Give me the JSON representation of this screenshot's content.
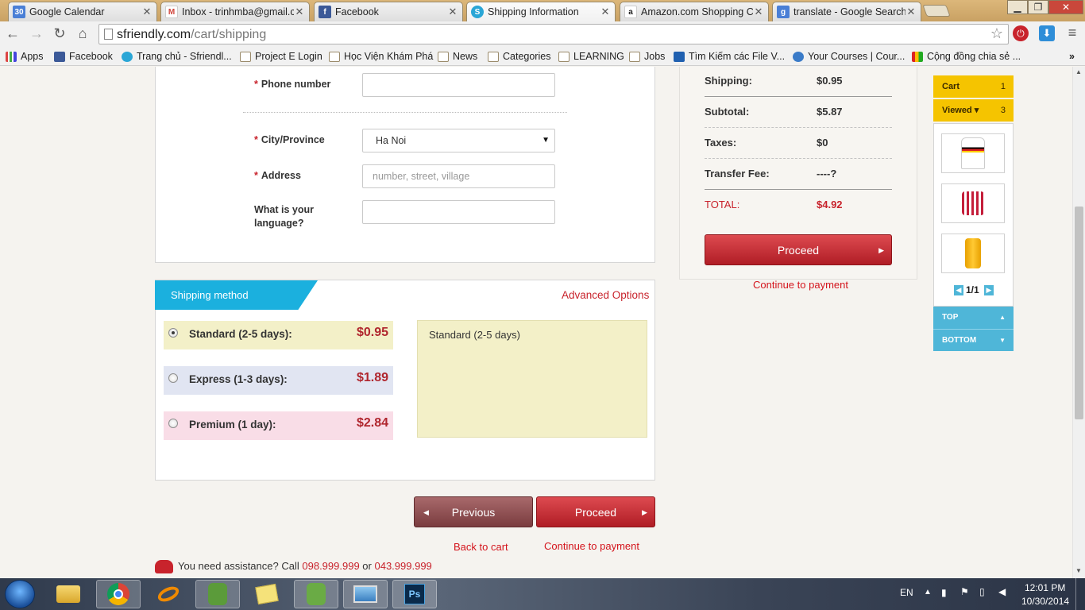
{
  "browser": {
    "tabs": [
      {
        "title": "Google Calendar",
        "icon": "calendar-icon",
        "icon_text": "30",
        "icon_color": "#4a7fd6"
      },
      {
        "title": "Inbox - trinhmba@gmail.c",
        "icon": "gmail-icon",
        "icon_text": "M",
        "icon_color": "#d0433a"
      },
      {
        "title": "Facebook",
        "icon": "facebook-icon",
        "icon_text": "f",
        "icon_color": "#3b5998"
      },
      {
        "title": "Shipping Information",
        "icon": "sfriendly-icon",
        "icon_text": "S",
        "icon_color": "#2aa6d6"
      },
      {
        "title": "Amazon.com Shopping C",
        "icon": "amazon-icon",
        "icon_text": "a",
        "icon_color": "#222222"
      },
      {
        "title": "translate - Google Search",
        "icon": "google-icon",
        "icon_text": "g",
        "icon_color": "#4a7fd6"
      }
    ],
    "url_host": "sfriendly.com",
    "url_path": "/cart/shipping",
    "bookmarks": [
      {
        "label": "Apps",
        "icon": "apps-icon"
      },
      {
        "label": "Facebook",
        "icon": "facebook-icon"
      },
      {
        "label": "Trang chủ - Sfriendl...",
        "icon": "sfriendly-icon"
      },
      {
        "label": "Project E Login",
        "icon": "folder-icon"
      },
      {
        "label": "Học Viện Khám Phá",
        "icon": "folder-icon"
      },
      {
        "label": "News",
        "icon": "folder-icon"
      },
      {
        "label": "Categories",
        "icon": "folder-icon"
      },
      {
        "label": "LEARNING",
        "icon": "folder-icon"
      },
      {
        "label": "Jobs",
        "icon": "folder-icon"
      },
      {
        "label": "Tìm Kiếm các File V...",
        "icon": "search-icon"
      },
      {
        "label": "Your Courses | Cour...",
        "icon": "coursera-icon"
      },
      {
        "label": "Cộng đồng chia sẻ ...",
        "icon": "chart-icon"
      }
    ],
    "more_bookmarks": "»"
  },
  "form": {
    "phone_label": "Phone number",
    "phone_value": "",
    "city_label": "City/Province",
    "city_value": "Ha Noi",
    "address_label": "Address",
    "address_placeholder": "number, street, village",
    "language_label": "What is your language?",
    "language_value": "",
    "required_mark": "*"
  },
  "shipping_method": {
    "title": "Shipping method",
    "advanced_link": "Advanced Options",
    "options": [
      {
        "label": "Standard (2-5 days):",
        "price": "$0.95",
        "selected": true,
        "bg": "#f3f0c8"
      },
      {
        "label": "Express (1-3 days):",
        "price": "$1.89",
        "selected": false,
        "bg": "#e1e5f2"
      },
      {
        "label": "Premium (1 day):",
        "price": "$2.84",
        "selected": false,
        "bg": "#f9dde7"
      }
    ],
    "description": "Standard (2-5 days)"
  },
  "nav": {
    "previous_label": "Previous",
    "proceed_label": "Proceed",
    "back_to_cart": "Back to cart",
    "continue_to_payment": "Continue to payment"
  },
  "assistance": {
    "text_before": "You need assistance? Call",
    "phone1": "098.999.999",
    "or": "or",
    "phone2": "043.999.999"
  },
  "summary": {
    "rows": [
      {
        "label": "Shipping:",
        "value": "$0.95"
      },
      {
        "label": "Subtotal:",
        "value": "$5.87"
      },
      {
        "label": "Taxes:",
        "value": "$0"
      },
      {
        "label": "Transfer Fee:",
        "value": "----?"
      }
    ],
    "total_label": "TOTAL:",
    "total_value": "$4.92",
    "proceed_label": "Proceed",
    "continue_link": "Continue to payment"
  },
  "side_widget": {
    "cart_label": "Cart",
    "cart_count": "1",
    "viewed_label": "Viewed ▾",
    "viewed_count": "3",
    "pager": "1/1",
    "top_label": "TOP",
    "bottom_label": "BOTTOM"
  },
  "taskbar": {
    "language": "EN",
    "time": "12:01 PM",
    "date": "10/30/2014",
    "apps": [
      "start-orb-icon",
      "file-explorer-icon",
      "chrome-icon",
      "app-orange-icon",
      "evernote-icon",
      "sticky-notes-icon",
      "evernote-icon",
      "photo-viewer-icon",
      "photoshop-icon"
    ]
  },
  "colors": {
    "accent_red": "#c8232c",
    "price_red": "#b0262e",
    "tab_blue": "#1bb0de",
    "widget_yellow": "#f5c400",
    "widget_blue": "#4fb6d8"
  }
}
